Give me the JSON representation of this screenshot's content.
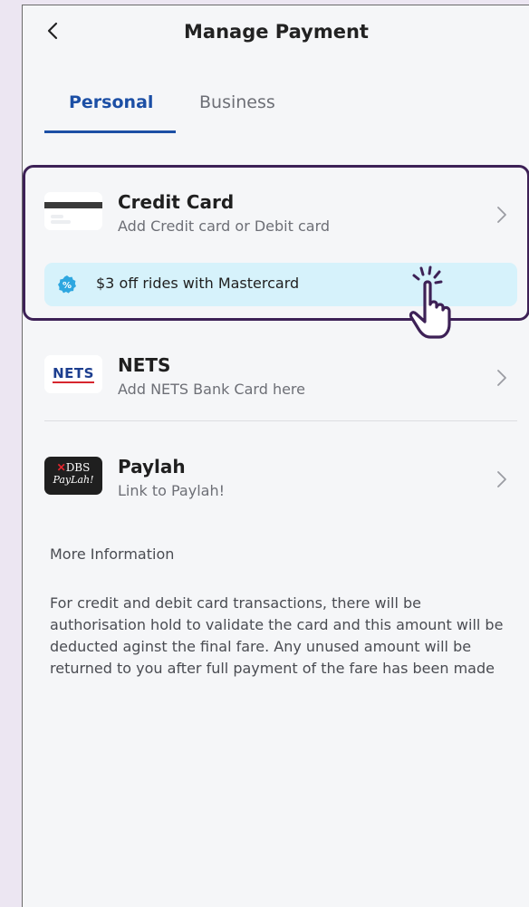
{
  "header": {
    "title": "Manage Payment"
  },
  "tabs": [
    {
      "label": "Personal",
      "active": true
    },
    {
      "label": "Business",
      "active": false
    }
  ],
  "payment_methods": [
    {
      "name": "Credit Card",
      "subtitle": "Add Credit card or Debit card",
      "icon": "card-icon"
    },
    {
      "name": "NETS",
      "subtitle": "Add NETS Bank Card here",
      "icon": "nets-logo",
      "logo_text": "NETS"
    },
    {
      "name": "Paylah",
      "subtitle": "Link to Paylah!",
      "icon": "dbs-paylah-logo",
      "logo_text_line1": "DBS",
      "logo_text_line2": "PayLah!"
    }
  ],
  "promo": {
    "text": "$3 off rides with Mastercard",
    "icon": "percent-badge-icon"
  },
  "more_info": {
    "title": "More Information",
    "body": "For credit and debit card transactions, there will be authorisation hold to validate the card and this amount will be deducted aginst the final fare. Any unused amount will be returned to you after full payment of the fare has been made"
  },
  "colors": {
    "accent": "#1c4fa5",
    "highlight_border": "#3d2156",
    "promo_bg": "#d6f2fb",
    "badge": "#2ea7e0"
  }
}
